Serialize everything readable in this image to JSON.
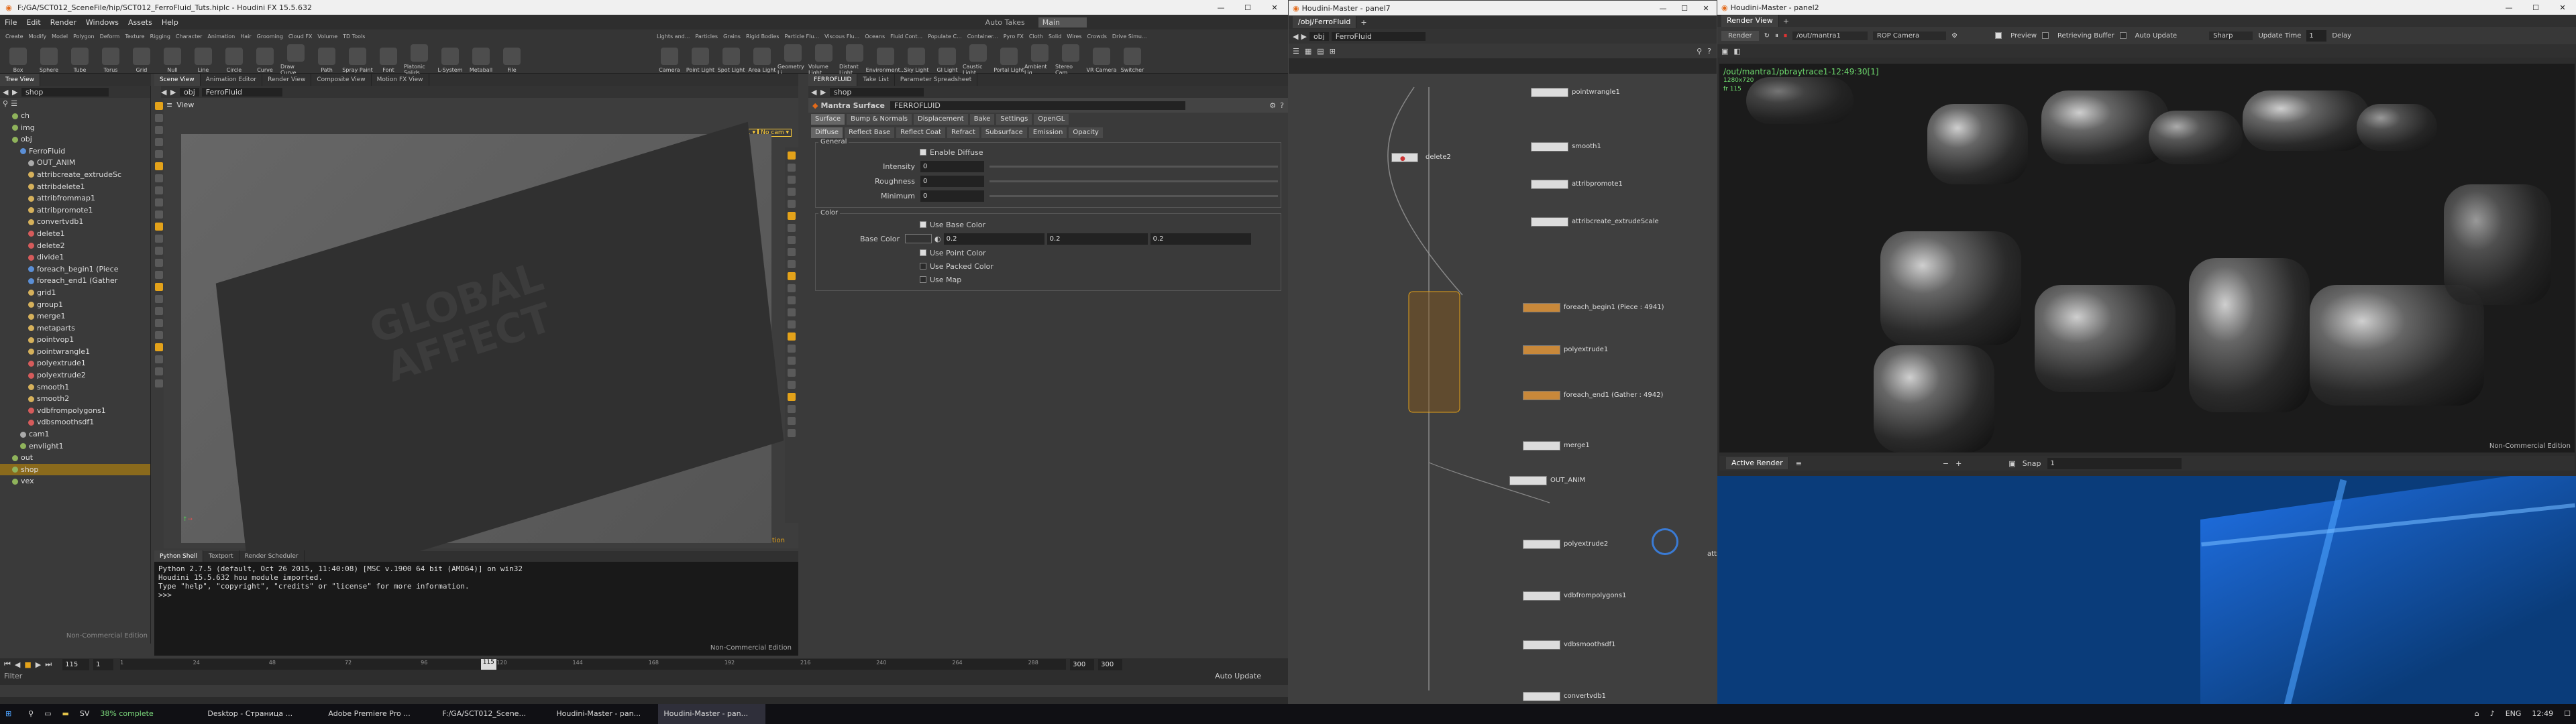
{
  "main_window": {
    "title": "F:/GA/SCT012_SceneFile/hip/SCT012_FerroFluid_Tuts.hiplc - Houdini FX 15.5.632",
    "menu": [
      "File",
      "Edit",
      "Render",
      "Windows",
      "Assets",
      "Help"
    ],
    "auto_takes": "Auto Takes",
    "desktop_mode": "Main",
    "shelf_tabs_left": [
      "Create",
      "Modify",
      "Model",
      "Polygon",
      "Deform",
      "Texture",
      "Rigging",
      "Character",
      "Animation",
      "Hair",
      "Grooming",
      "Cloud FX",
      "Volume",
      "TD Tools"
    ],
    "shelf_tools_left": [
      "Box",
      "Sphere",
      "Tube",
      "Torus",
      "Grid",
      "Null",
      "Line",
      "Circle",
      "Curve",
      "Draw Curve",
      "Path",
      "Spray Paint",
      "Font",
      "Platonic Solids",
      "L-System",
      "Metaball",
      "File"
    ],
    "shelf_tabs_right": [
      "Lights and...",
      "Particles",
      "Grains",
      "Rigid Bodies",
      "Particle Flu...",
      "Viscous Flu...",
      "Oceans",
      "Fluid Cont...",
      "Populate C...",
      "Container...",
      "Pyro FX",
      "Cloth",
      "Solid",
      "Wires",
      "Crowds",
      "Drive Simu..."
    ],
    "shelf_tools_right": [
      "Camera",
      "Point Light",
      "Spot Light",
      "Area Light",
      "Geometry Li...",
      "Volume Light",
      "Distant Light",
      "Environment...",
      "Sky Light",
      "GI Light",
      "Caustic Light",
      "Portal Light",
      "Ambient Lig...",
      "Stereo Cam...",
      "VR Camera",
      "Switcher"
    ]
  },
  "tree_panel": {
    "tabs": [
      "Tree View",
      "Scene View",
      "Animation Editor",
      "Render View",
      "Composite View",
      "Motion FX View"
    ],
    "path": "shop",
    "items": [
      {
        "label": "ch",
        "indent": 1,
        "color": "#8fb35b"
      },
      {
        "label": "img",
        "indent": 1,
        "color": "#8fb35b"
      },
      {
        "label": "obj",
        "indent": 1,
        "color": "#8fb35b"
      },
      {
        "label": "FerroFluid",
        "indent": 2,
        "color": "#5b8fd6"
      },
      {
        "label": "OUT_ANIM",
        "indent": 3,
        "color": "#aaaaaa"
      },
      {
        "label": "attribcreate_extrudeSc",
        "indent": 3,
        "color": "#d6b15b"
      },
      {
        "label": "attribdelete1",
        "indent": 3,
        "color": "#d6b15b"
      },
      {
        "label": "attribfrommap1",
        "indent": 3,
        "color": "#d6b15b"
      },
      {
        "label": "attribpromote1",
        "indent": 3,
        "color": "#d6b15b"
      },
      {
        "label": "convertvdb1",
        "indent": 3,
        "color": "#d6b15b"
      },
      {
        "label": "delete1",
        "indent": 3,
        "color": "#d65b5b"
      },
      {
        "label": "delete2",
        "indent": 3,
        "color": "#d65b5b"
      },
      {
        "label": "divide1",
        "indent": 3,
        "color": "#d65b5b"
      },
      {
        "label": "foreach_begin1 (Piece",
        "indent": 3,
        "color": "#5b8fd6"
      },
      {
        "label": "foreach_end1 (Gather",
        "indent": 3,
        "color": "#5b8fd6"
      },
      {
        "label": "grid1",
        "indent": 3,
        "color": "#d6b15b"
      },
      {
        "label": "group1",
        "indent": 3,
        "color": "#d6b15b"
      },
      {
        "label": "merge1",
        "indent": 3,
        "color": "#d6b15b"
      },
      {
        "label": "metaparts",
        "indent": 3,
        "color": "#d6b15b"
      },
      {
        "label": "pointvop1",
        "indent": 3,
        "color": "#d6b15b"
      },
      {
        "label": "pointwrangle1",
        "indent": 3,
        "color": "#d6b15b"
      },
      {
        "label": "polyextrude1",
        "indent": 3,
        "color": "#d65b5b"
      },
      {
        "label": "polyextrude2",
        "indent": 3,
        "color": "#d65b5b"
      },
      {
        "label": "smooth1",
        "indent": 3,
        "color": "#d6b15b"
      },
      {
        "label": "smooth2",
        "indent": 3,
        "color": "#d6b15b"
      },
      {
        "label": "vdbfrompolygons1",
        "indent": 3,
        "color": "#d65b5b"
      },
      {
        "label": "vdbsmoothsdf1",
        "indent": 3,
        "color": "#d65b5b"
      },
      {
        "label": "cam1",
        "indent": 2,
        "color": "#aaaaaa"
      },
      {
        "label": "envlight1",
        "indent": 2,
        "color": "#8fb35b"
      },
      {
        "label": "out",
        "indent": 1,
        "color": "#8fb35b"
      },
      {
        "label": "shop",
        "indent": 1,
        "color": "#8fb35b",
        "selected": true
      },
      {
        "label": "vex",
        "indent": 1,
        "color": "#8fb35b"
      }
    ],
    "footer": "Non-Commercial Edition"
  },
  "viewport": {
    "path_obj": "obj",
    "path_node": "FerroFluid",
    "view_label": "View",
    "persp_label": "persp1 ▾",
    "cam_label": "No cam ▾",
    "watermark_text": "GLOBAL AFFECT",
    "badge": "Non-Commercial Edition"
  },
  "console": {
    "tabs": [
      "Python Shell",
      "Textport",
      "Render Scheduler"
    ],
    "lines": [
      "Python 2.7.5 (default, Oct 26 2015, 11:40:08) [MSC v.1900 64 bit (AMD64)] on win32",
      "Houdini 15.5.632 hou module imported.",
      "Type \"help\", \"copyright\", \"credits\" or \"license\" for more information.",
      ">>>"
    ],
    "badge": "Non-Commercial Edition"
  },
  "param": {
    "tabs_top": [
      "FERROFLUID",
      "Take List",
      "Parameter Spreadsheet"
    ],
    "path": "shop",
    "node_type": "Mantra Surface",
    "node_name": "FERROFLUID",
    "tabs1": [
      "Surface",
      "Bump & Normals",
      "Displacement",
      "Bake",
      "Settings",
      "OpenGL"
    ],
    "tabs2": [
      "Diffuse",
      "Reflect Base",
      "Reflect Coat",
      "Refract",
      "Subsurface",
      "Emission",
      "Opacity"
    ],
    "general_label": "General",
    "enable_diffuse": "Enable Diffuse",
    "intensity_label": "Intensity",
    "intensity_value": "0",
    "roughness_label": "Roughness",
    "roughness_value": "0",
    "minimum_label": "Minimum",
    "minimum_value": "0",
    "color_label": "Color",
    "use_base_color": "Use Base Color",
    "base_color_label": "Base Color",
    "base_color_values": [
      "0.2",
      "0.2",
      "0.2"
    ],
    "use_point_color": "Use Point Color",
    "use_packed_color": "Use Packed Color",
    "use_map": "Use Map"
  },
  "timeline": {
    "frame": "115",
    "start": "1",
    "end": "300",
    "end2": "300",
    "ticks": [
      "1",
      "24",
      "48",
      "72",
      "96",
      "120",
      "144",
      "168",
      "192",
      "216",
      "240",
      "264",
      "288"
    ],
    "current_marker": "115",
    "filter_label": "Filter",
    "auto_update": "Auto Update"
  },
  "node_editor": {
    "title": "Houdini-Master - panel7",
    "tab": "/obj/FerroFluid",
    "path_obj": "obj",
    "path_node": "FerroFluid",
    "nodes": [
      {
        "label": "pointwrangle1"
      },
      {
        "label": "smooth1"
      },
      {
        "label": "attribpromote1"
      },
      {
        "label": "attribcreate_extrudeScale"
      },
      {
        "label": "foreach_begin1 (Piece : 4941)"
      },
      {
        "label": "polyextrude1"
      },
      {
        "label": "foreach_end1 (Gather : 4942)"
      },
      {
        "label": "merge1"
      },
      {
        "label": "OUT_ANIM"
      },
      {
        "label": "polyextrude2"
      },
      {
        "label": "vdbfrompolygons1"
      },
      {
        "label": "vdbsmoothsdf1"
      },
      {
        "label": "convertvdb1"
      },
      {
        "label": "delete2"
      }
    ],
    "partial_label": "attri"
  },
  "render_view": {
    "title": "Houdini-Master - panel2",
    "tab": "Render View",
    "render_button": "Render",
    "rop": "/out/mantra1",
    "camera": "ROP Camera",
    "preview": "Preview",
    "rebuffer": "Retrieving Buffer",
    "auto_update": "Auto Update",
    "sharp": "Sharp",
    "update_time_label": "Update Time",
    "update_time": "1",
    "delay": "Delay",
    "info1": "/out/mantra1/pbraytrace1-12:49:30[1]",
    "info2": "1280x720",
    "info3": "fr 115",
    "badge": "Non-Commercial Edition",
    "bottom_tab": "Active Render",
    "snap_label": "Snap",
    "snap_value": "1"
  },
  "taskbar": {
    "items": [
      "SV",
      "38% complete",
      "Desktop - Страница ...",
      "Adobe Premiere Pro ...",
      "F:/GA/SCT012_Scene...",
      "Houdini-Master - pan...",
      "Houdini-Master - pan..."
    ],
    "lang": "ENG",
    "time": "12:49"
  },
  "colors": {
    "accent": "#e3a21a",
    "selected": "#8a6a1c",
    "blue": "#0a3c7a"
  }
}
